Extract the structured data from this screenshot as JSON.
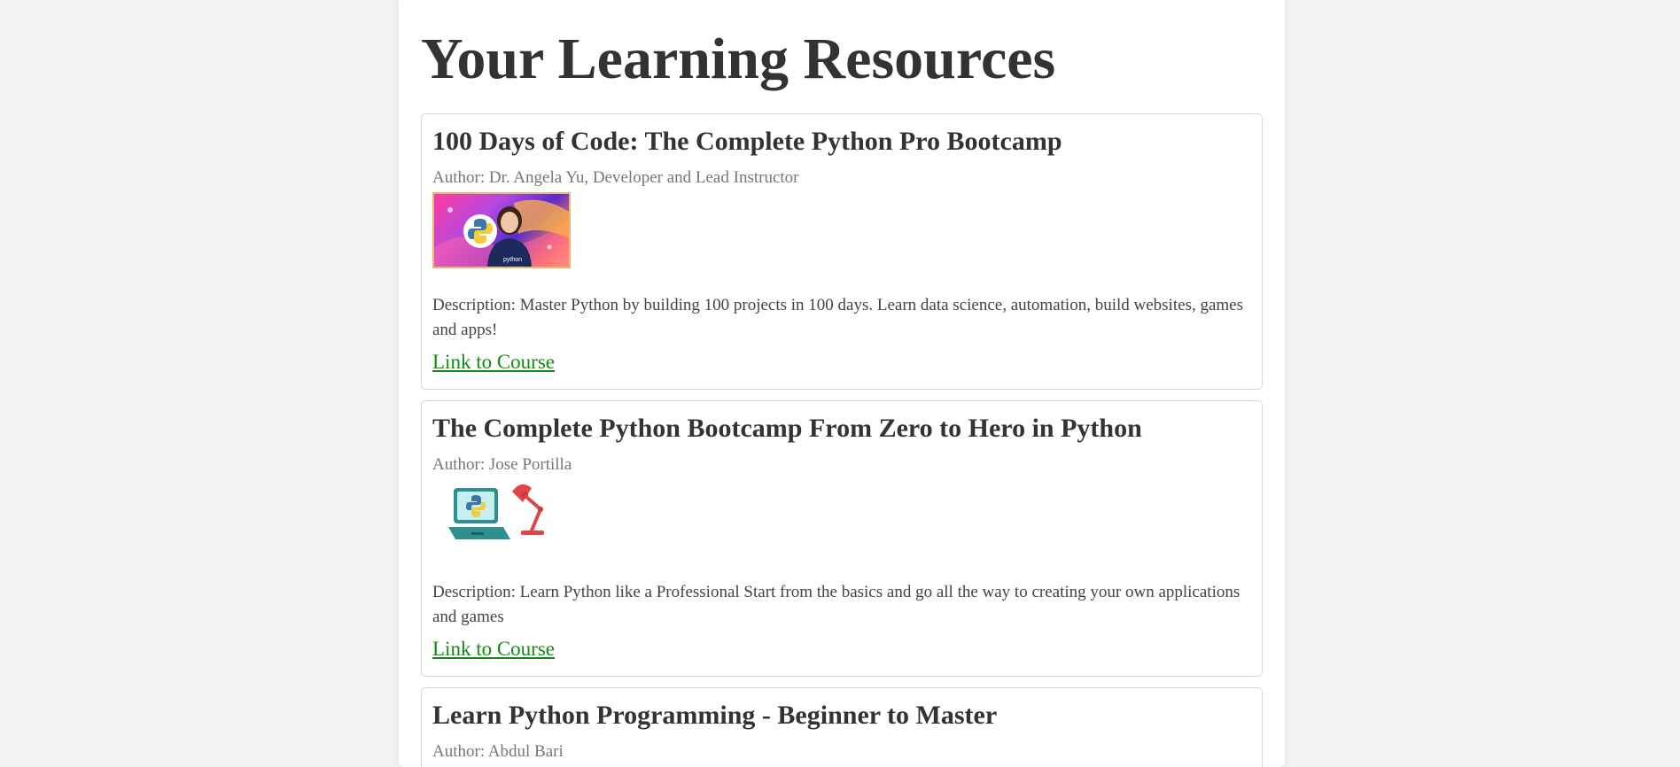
{
  "page": {
    "title": "Your Learning Resources"
  },
  "courses": [
    {
      "title": "100 Days of Code: The Complete Python Pro Bootcamp",
      "author": "Author: Dr. Angela Yu, Developer and Lead Instructor",
      "thumbnail_text": "python",
      "description": "Description: Master Python by building 100 projects in 100 days. Learn data science, automation, build websites, games and apps!",
      "link_label": "Link to Course"
    },
    {
      "title": "The Complete Python Bootcamp From Zero to Hero in Python",
      "author": "Author: Jose Portilla",
      "description": "Description: Learn Python like a Professional Start from the basics and go all the way to creating your own applications and games",
      "link_label": "Link to Course"
    },
    {
      "title": "Learn Python Programming - Beginner to Master",
      "author": "Author: Abdul Bari"
    }
  ],
  "colors": {
    "link": "#128a12",
    "heading": "#333333",
    "author": "#777777",
    "background": "#f3f3f3",
    "card_border": "#d6d6d6"
  },
  "icons": [
    "python-logo-icon",
    "laptop-icon",
    "desk-lamp-icon"
  ]
}
